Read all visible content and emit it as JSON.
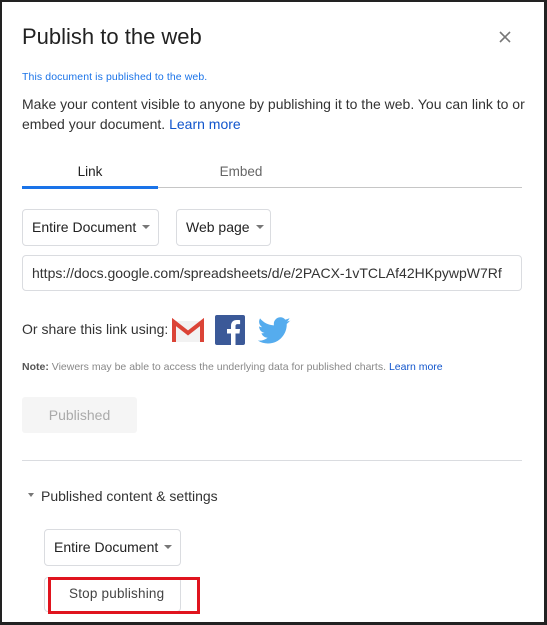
{
  "dialog": {
    "title": "Publish to the web",
    "close_icon": "close-icon",
    "status_text": "This document is published to the web.",
    "description": "Make your content visible to anyone by publishing it to the web. You can link to or embed your document.",
    "learn_more": "Learn more"
  },
  "tabs": [
    {
      "label": "Link",
      "active": true
    },
    {
      "label": "Embed",
      "active": false
    }
  ],
  "link": {
    "scope_dropdown": "Entire Document",
    "format_dropdown": "Web page",
    "url": "https://docs.google.com/spreadsheets/d/e/2PACX-1vTCLAf42HKpywpW7Rf",
    "share_label": "Or share this link using:",
    "share_icons": [
      "gmail-icon",
      "facebook-icon",
      "twitter-icon"
    ],
    "note_label": "Note:",
    "note_text": "Viewers may be able to access the underlying data for published charts.",
    "note_learn_more": "Learn more",
    "published_button": "Published"
  },
  "settings": {
    "section_label": "Published content & settings",
    "scope_dropdown": "Entire Document",
    "stop_button": "Stop publishing"
  },
  "colors": {
    "accent": "#1a73e8",
    "link": "#1155cc",
    "highlight": "#e0141e"
  }
}
